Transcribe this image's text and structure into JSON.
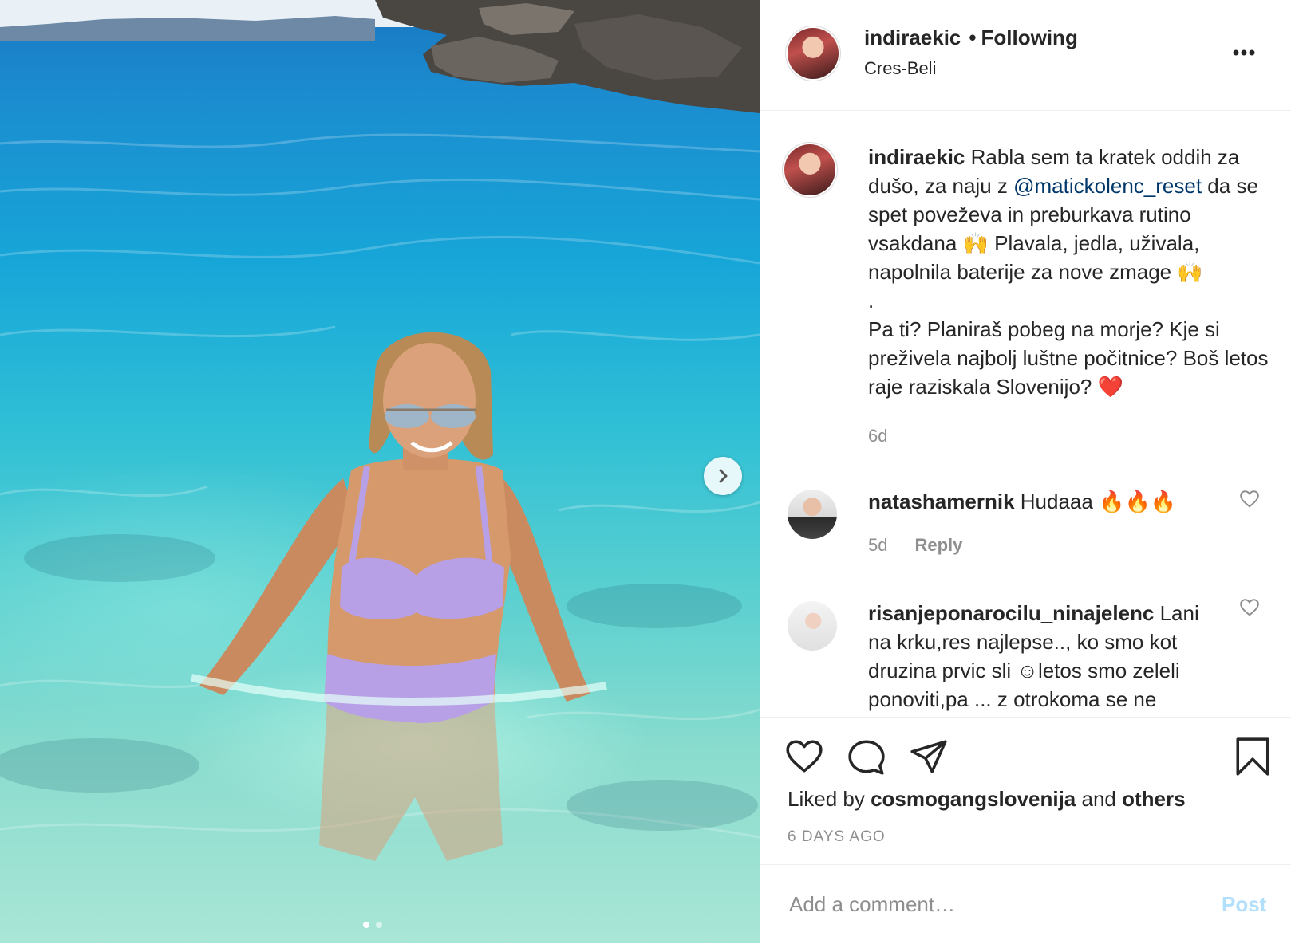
{
  "post": {
    "username": "indiraekic",
    "separator": "•",
    "follow_status": "Following",
    "location": "Cres-Beli"
  },
  "caption": {
    "username": "indiraekic",
    "text_before_mention": "Rabla sem ta kratek oddih za dušo, za naju z",
    "mention": "@matickolenc_reset",
    "text_line_after": "da se spet poveževa in preburkava rutino vsakdana 🙌 Plavala, jedla, uživala, napolnila baterije za nove zmage 🙌",
    "dot_line": ".",
    "text_question": "Pa ti? Planiraš pobeg na morje? Kje si preživela najbolj luštne počitnice? Boš letos raje raziskala Slovenijo? ❤️",
    "time": "6d"
  },
  "comments": [
    {
      "username": "natashamernik",
      "text": "Hudaaa 🔥🔥🔥",
      "time": "5d",
      "reply_label": "Reply"
    },
    {
      "username": "risanjeponarocilu_ninajelenc",
      "text": "Lani na krku,res najlepse.., ko smo kot druzina prvic sli ☺letos smo zeleli ponoviti,pa ... z otrokoma se ne"
    }
  ],
  "likes": {
    "prefix": "Liked by",
    "user": "cosmogangslovenija",
    "connector": "and",
    "others": "others"
  },
  "timestamp": "6 DAYS AGO",
  "comment_box": {
    "placeholder": "Add a comment…",
    "post_label": "Post"
  },
  "carousel": {
    "current": 1,
    "total": 2
  },
  "icons": {
    "more": "more-options-icon",
    "like": "heart-icon",
    "comment": "comment-icon",
    "share": "share-icon",
    "save": "bookmark-icon",
    "next": "chevron-right-icon"
  },
  "colors": {
    "mention": "#00376b",
    "secondary_text": "#8e8e8e",
    "post_disabled": "#b2dffc"
  }
}
